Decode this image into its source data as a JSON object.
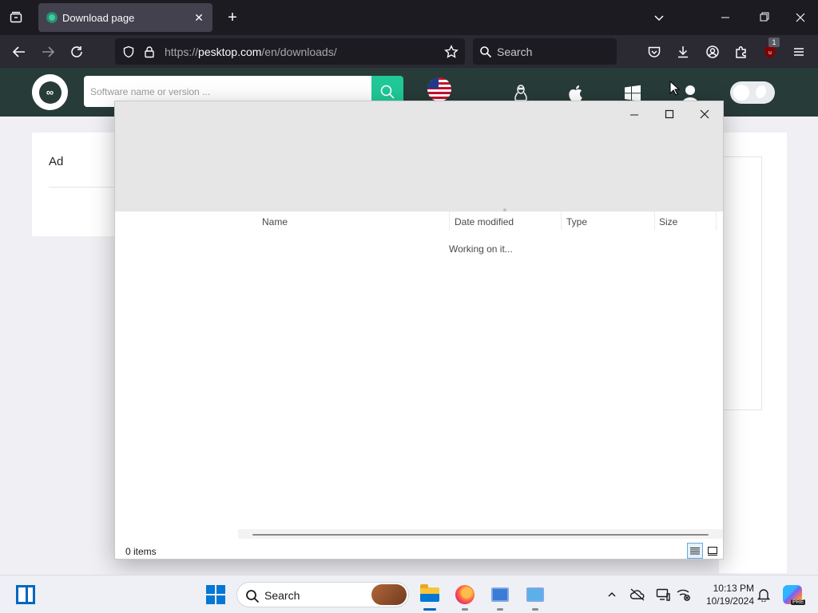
{
  "browser": {
    "tab": {
      "title": "Download page"
    },
    "url": {
      "prefix": "https://",
      "host": "pesktop.com",
      "path": "/en/downloads/"
    },
    "search_placeholder": "Search",
    "extension_badge": "1"
  },
  "site": {
    "search_placeholder": "Software name or version ...",
    "ad_label": "Ad",
    "accent_color": "#20c997",
    "header_color": "#273b39"
  },
  "dialog": {
    "columns": [
      "Name",
      "Date modified",
      "Type",
      "Size"
    ],
    "status_message": "Working on it...",
    "item_count": "0 items"
  },
  "taskbar": {
    "search_label": "Search",
    "time": "10:13 PM",
    "date": "10/19/2024",
    "copilot_badge": "PRE"
  },
  "icons": [
    "tab-list-icon",
    "close-icon",
    "plus-icon",
    "chevron-down-icon",
    "back-icon",
    "forward-icon",
    "reload-icon",
    "shield-icon",
    "lock-icon",
    "star-icon",
    "search-icon",
    "pocket-icon",
    "download-icon",
    "account-icon",
    "extensions-icon",
    "ublock-icon",
    "menu-icon",
    "linux-icon",
    "apple-icon",
    "windows-icon",
    "user-icon",
    "moon-icon"
  ]
}
